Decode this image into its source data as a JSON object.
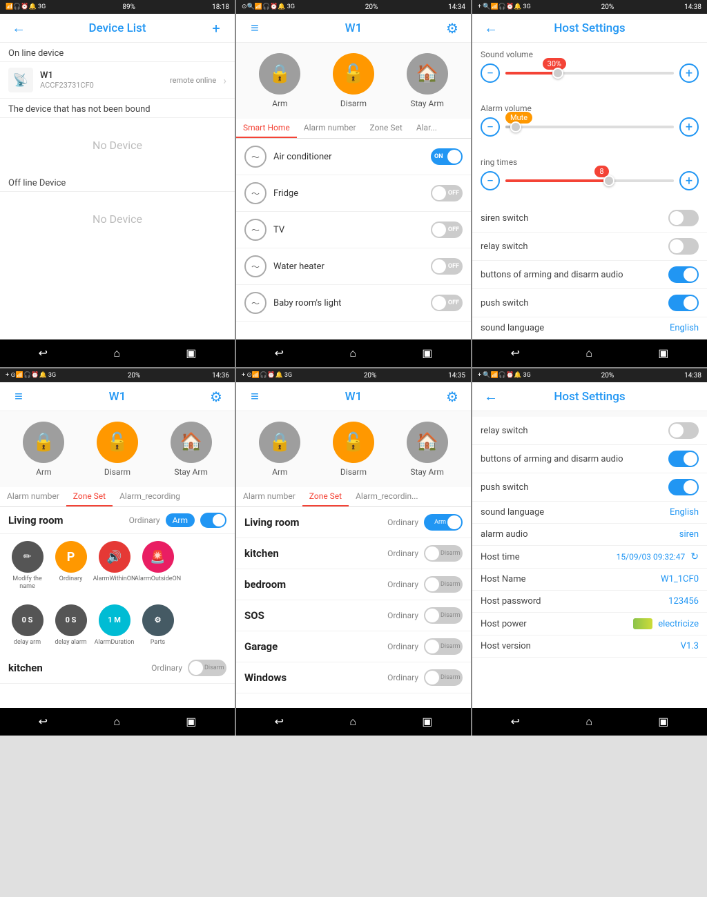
{
  "screens": [
    {
      "id": "device-list",
      "statusBar": {
        "time": "18:18",
        "battery": "89%",
        "network": "3G"
      },
      "header": {
        "title": "Device List",
        "leftIcon": "←",
        "rightIcon": "+"
      },
      "sections": [
        {
          "label": "On line device",
          "devices": [
            {
              "name": "W1",
              "id": "ACCF23731CF0",
              "status": "remote online",
              "icon": "📡"
            }
          ]
        },
        {
          "label": "The device that has not been bound",
          "noDevice": "No Device"
        },
        {
          "label": "Off line Device",
          "noDevice": "No Device"
        }
      ]
    },
    {
      "id": "w1-smart-home",
      "statusBar": {
        "time": "14:34",
        "battery": "20%",
        "network": "3G"
      },
      "header": {
        "title": "W1",
        "leftIcon": "≡",
        "rightIcon": "⚙"
      },
      "armButtons": [
        {
          "label": "Arm",
          "style": "gray",
          "icon": "🔒"
        },
        {
          "label": "Disarm",
          "style": "orange",
          "icon": "🔓"
        },
        {
          "label": "Stay Arm",
          "style": "gray",
          "icon": "🏠"
        }
      ],
      "tabs": [
        {
          "label": "Smart Home",
          "active": true
        },
        {
          "label": "Alarm number",
          "active": false
        },
        {
          "label": "Zone Set",
          "active": false
        },
        {
          "label": "Alar...",
          "active": false
        }
      ],
      "smartItems": [
        {
          "name": "Air conditioner",
          "state": "on"
        },
        {
          "name": "Fridge",
          "state": "off"
        },
        {
          "name": "TV",
          "state": "off"
        },
        {
          "name": "Water heater",
          "state": "off"
        },
        {
          "name": "Baby room's light",
          "state": "off"
        }
      ]
    },
    {
      "id": "host-settings-1",
      "statusBar": {
        "time": "14:38",
        "battery": "20%",
        "network": "3G"
      },
      "header": {
        "title": "Host Settings",
        "leftIcon": "←"
      },
      "soundVolume": {
        "label": "Sound volume",
        "value": 30,
        "percent": "30%"
      },
      "alarmVolume": {
        "label": "Alarm volume",
        "value": "Mute"
      },
      "ringTimes": {
        "label": "ring times",
        "value": 8
      },
      "rows": [
        {
          "label": "siren switch",
          "type": "toggle",
          "state": "off"
        },
        {
          "label": "relay switch",
          "type": "toggle",
          "state": "off"
        },
        {
          "label": "buttons of arming and disarm audio",
          "type": "toggle",
          "state": "on"
        },
        {
          "label": "push switch",
          "type": "toggle",
          "state": "on"
        },
        {
          "label": "sound language",
          "type": "value",
          "value": "English"
        }
      ]
    },
    {
      "id": "w1-zone-set-1",
      "statusBar": {
        "time": "14:36",
        "battery": "20%",
        "network": "3G"
      },
      "header": {
        "title": "W1",
        "leftIcon": "≡",
        "rightIcon": "⚙"
      },
      "armButtons": [
        {
          "label": "Arm",
          "style": "gray",
          "icon": "🔒"
        },
        {
          "label": "Disarm",
          "style": "orange",
          "icon": "🔓"
        },
        {
          "label": "Stay Arm",
          "style": "gray",
          "icon": "🏠"
        }
      ],
      "tabs": [
        {
          "label": "Alarm number",
          "active": false
        },
        {
          "label": "Zone Set",
          "active": true
        },
        {
          "label": "Alarm_recording",
          "active": false
        }
      ],
      "livingRoom": {
        "name": "Living room",
        "type": "Ordinary",
        "armState": "on"
      },
      "zoneIcons": [
        {
          "label": "Modify the name",
          "style": "dark",
          "icon": "✏️"
        },
        {
          "label": "Ordinary",
          "style": "orange",
          "icon": "P"
        },
        {
          "label": "AlarmWithinON",
          "style": "red",
          "icon": "🔊"
        },
        {
          "label": "AlarmOutsideON",
          "style": "pink",
          "icon": "🚨"
        }
      ],
      "delayIcons": [
        {
          "label": "delay arm",
          "value": "0 S",
          "style": "dark"
        },
        {
          "label": "delay alarm",
          "value": "0 S",
          "style": "dark"
        },
        {
          "label": "AlarmDuration",
          "value": "1 M",
          "style": "teal"
        },
        {
          "label": "Parts",
          "icon": "⚙",
          "style": "dark-teal"
        }
      ],
      "rooms": [
        {
          "name": "kitchen",
          "type": "Ordinary",
          "state": "off"
        }
      ]
    },
    {
      "id": "w1-zone-set-2",
      "statusBar": {
        "time": "14:35",
        "battery": "20%",
        "network": "3G"
      },
      "header": {
        "title": "W1",
        "leftIcon": "≡",
        "rightIcon": "⚙"
      },
      "armButtons": [
        {
          "label": "Arm",
          "style": "gray",
          "icon": "🔒"
        },
        {
          "label": "Disarm",
          "style": "orange",
          "icon": "🔓"
        },
        {
          "label": "Stay Arm",
          "style": "gray",
          "icon": "🏠"
        }
      ],
      "tabs": [
        {
          "label": "Alarm number",
          "active": false
        },
        {
          "label": "Zone Set",
          "active": true
        },
        {
          "label": "Alarm_recordin...",
          "active": false
        }
      ],
      "rooms": [
        {
          "name": "Living room",
          "type": "Ordinary",
          "state": "arm"
        },
        {
          "name": "kitchen",
          "type": "Ordinary",
          "state": "off"
        },
        {
          "name": "bedroom",
          "type": "Ordinary",
          "state": "off"
        },
        {
          "name": "SOS",
          "type": "Ordinary",
          "state": "off"
        },
        {
          "name": "Garage",
          "type": "Ordinary",
          "state": "off"
        },
        {
          "name": "Windows",
          "type": "Ordinary",
          "state": "off"
        }
      ]
    },
    {
      "id": "host-settings-2",
      "statusBar": {
        "time": "14:38",
        "battery": "20%",
        "network": "3G"
      },
      "header": {
        "title": "Host Settings",
        "leftIcon": "←"
      },
      "rows": [
        {
          "label": "relay switch",
          "type": "toggle",
          "state": "off"
        },
        {
          "label": "buttons of arming and disarm audio",
          "type": "toggle",
          "state": "on"
        },
        {
          "label": "push switch",
          "type": "toggle",
          "state": "on"
        },
        {
          "label": "sound language",
          "type": "value",
          "value": "English"
        },
        {
          "label": "alarm audio",
          "type": "value",
          "value": "siren"
        },
        {
          "label": "Host time",
          "type": "time",
          "value": "15/09/03  09:32:47"
        },
        {
          "label": "Host Name",
          "type": "value",
          "value": "W1_1CF0"
        },
        {
          "label": "Host password",
          "type": "value",
          "value": "123456"
        },
        {
          "label": "Host power",
          "type": "power",
          "value": "electricize"
        },
        {
          "label": "Host version",
          "type": "value",
          "value": "V1.3"
        }
      ]
    }
  ]
}
